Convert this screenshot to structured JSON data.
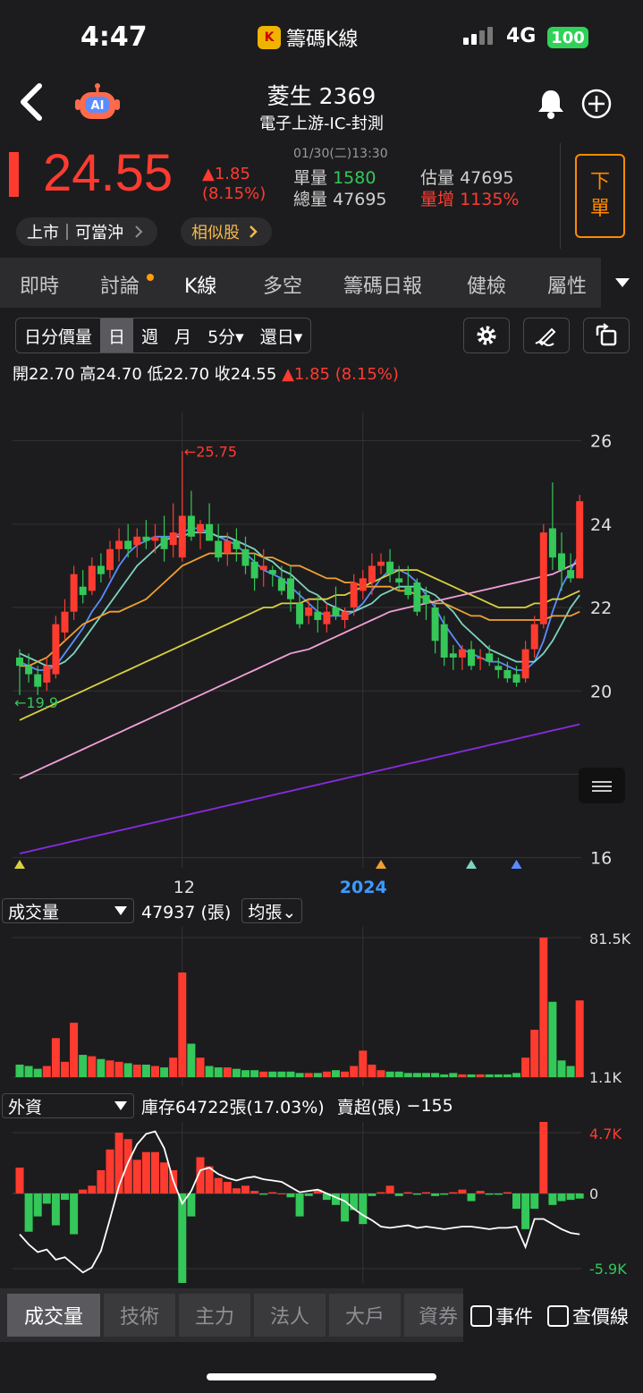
{
  "status_bar": {
    "time": "4:47",
    "app_name": "籌碼K線",
    "network": "4G",
    "battery": "100"
  },
  "header": {
    "stock_name": "菱生 2369",
    "industry": "電子上游-IC-封測",
    "back_icon": "chevron-left-icon",
    "ai_icon": "robot-ai-icon",
    "bell_icon": "bell-icon",
    "add_icon": "plus-circle-icon"
  },
  "quote": {
    "price": "24.55",
    "change": "▲1.85",
    "change_pct": "(8.15%)",
    "timestamp": "01/30(二)13:30",
    "single_vol_label": "單量",
    "single_vol": "1580",
    "total_vol_label": "總量",
    "total_vol": "47695",
    "est_vol_label": "估量",
    "est_vol": "47695",
    "vol_increase_label": "量增",
    "vol_increase": "1135%",
    "order_button": [
      "下",
      "單"
    ],
    "market_pill": "上市｜可當沖",
    "similar_pill": "相似股"
  },
  "tabs": [
    "即時",
    "討論",
    "K線",
    "多空",
    "籌碼日報",
    "健檢",
    "屬性"
  ],
  "active_tab": "K線",
  "period_selector": {
    "items": [
      "日分價量",
      "日",
      "週",
      "月",
      "5分▾",
      "還日▾"
    ],
    "selected": "日"
  },
  "ohlc": {
    "open_label": "開",
    "open": "22.70",
    "high_label": "高",
    "high": "24.70",
    "low_label": "低",
    "low": "22.70",
    "close_label": "收",
    "close": "24.55",
    "change": "▲1.85 (8.15%)"
  },
  "chart_data": {
    "type": "candlestick",
    "y_ticks": [
      "26",
      "24",
      "22",
      "20",
      "18",
      "16"
    ],
    "ylim": [
      15.8,
      26.7
    ],
    "x_labels": [
      {
        "text": "12",
        "at": 18
      },
      {
        "text": "2024",
        "at": 38
      }
    ],
    "annotations": {
      "high": "←25.75",
      "low": "←19.9"
    },
    "candles": [
      [
        20.8,
        21.0,
        19.9,
        20.6
      ],
      [
        20.6,
        20.9,
        20.2,
        20.4
      ],
      [
        20.4,
        20.6,
        19.9,
        20.1
      ],
      [
        20.2,
        20.8,
        20.0,
        20.6
      ],
      [
        20.4,
        21.8,
        20.3,
        21.6
      ],
      [
        21.4,
        22.2,
        21.2,
        21.9
      ],
      [
        21.9,
        23.0,
        21.7,
        22.8
      ],
      [
        22.5,
        22.9,
        22.1,
        22.3
      ],
      [
        22.4,
        23.2,
        22.3,
        23.0
      ],
      [
        23.0,
        23.3,
        22.6,
        22.8
      ],
      [
        22.9,
        23.6,
        22.7,
        23.4
      ],
      [
        23.4,
        23.9,
        23.1,
        23.6
      ],
      [
        23.6,
        24.0,
        23.2,
        23.4
      ],
      [
        23.5,
        23.9,
        23.2,
        23.7
      ],
      [
        23.7,
        24.1,
        23.4,
        23.6
      ],
      [
        23.6,
        24.0,
        23.3,
        23.7
      ],
      [
        23.7,
        24.2,
        23.1,
        23.4
      ],
      [
        23.5,
        24.5,
        23.2,
        23.8
      ],
      [
        23.2,
        25.75,
        23.1,
        24.2
      ],
      [
        24.2,
        24.8,
        23.6,
        23.7
      ],
      [
        23.8,
        24.1,
        23.4,
        24.0
      ],
      [
        24.0,
        24.5,
        23.6,
        23.6
      ],
      [
        23.6,
        24.0,
        23.1,
        23.2
      ],
      [
        23.3,
        23.8,
        23.0,
        23.6
      ],
      [
        23.6,
        23.9,
        23.1,
        23.4
      ],
      [
        23.4,
        23.7,
        22.8,
        23.0
      ],
      [
        23.1,
        23.3,
        22.4,
        22.7
      ],
      [
        22.9,
        23.4,
        22.5,
        23.0
      ],
      [
        22.9,
        23.0,
        22.5,
        22.8
      ],
      [
        22.7,
        23.0,
        22.3,
        22.4
      ],
      [
        22.7,
        23.0,
        21.9,
        22.2
      ],
      [
        22.1,
        22.4,
        21.5,
        21.6
      ],
      [
        21.8,
        22.2,
        21.6,
        22.0
      ],
      [
        21.9,
        22.3,
        21.4,
        21.7
      ],
      [
        21.6,
        22.1,
        21.4,
        21.9
      ],
      [
        22.0,
        22.5,
        21.7,
        21.8
      ],
      [
        21.7,
        22.0,
        21.5,
        21.9
      ],
      [
        22.0,
        22.8,
        21.8,
        22.6
      ],
      [
        22.4,
        22.9,
        22.2,
        22.7
      ],
      [
        22.6,
        23.3,
        22.3,
        23.0
      ],
      [
        23.0,
        23.3,
        22.8,
        23.1
      ],
      [
        23.1,
        23.4,
        22.6,
        22.8
      ],
      [
        22.7,
        23.0,
        22.4,
        22.6
      ],
      [
        22.5,
        23.0,
        22.2,
        22.3
      ],
      [
        22.6,
        22.7,
        21.8,
        21.9
      ],
      [
        22.3,
        22.5,
        21.7,
        22.1
      ],
      [
        22.0,
        22.2,
        20.9,
        21.2
      ],
      [
        21.6,
        21.8,
        20.6,
        20.8
      ],
      [
        20.9,
        21.1,
        20.5,
        20.8
      ],
      [
        20.8,
        21.1,
        20.5,
        21.0
      ],
      [
        21.0,
        21.2,
        20.5,
        20.6
      ],
      [
        20.8,
        21.0,
        20.5,
        20.8
      ],
      [
        20.9,
        21.1,
        20.6,
        20.7
      ],
      [
        20.6,
        20.8,
        20.3,
        20.5
      ],
      [
        20.5,
        20.7,
        20.2,
        20.3
      ],
      [
        20.4,
        20.6,
        20.1,
        20.2
      ],
      [
        20.3,
        21.2,
        20.2,
        21.0
      ],
      [
        21.0,
        21.8,
        20.8,
        21.6
      ],
      [
        21.6,
        24.0,
        21.5,
        23.8
      ],
      [
        23.9,
        25.0,
        22.9,
        23.2
      ],
      [
        23.3,
        23.8,
        22.4,
        22.9
      ],
      [
        22.9,
        23.3,
        22.6,
        22.7
      ],
      [
        22.7,
        24.7,
        22.7,
        24.55
      ]
    ],
    "ma_lines": [
      {
        "color": "#5b8cff",
        "values": [
          20.7,
          20.6,
          20.5,
          20.5,
          20.6,
          20.9,
          21.2,
          21.5,
          21.9,
          22.2,
          22.6,
          23.0,
          23.3,
          23.5,
          23.6,
          23.7,
          23.7,
          23.7,
          23.8,
          23.9,
          23.9,
          23.8,
          23.7,
          23.6,
          23.5,
          23.3,
          23.1,
          22.9,
          22.8,
          22.7,
          22.5,
          22.3,
          22.1,
          21.9,
          21.8,
          21.8,
          21.8,
          21.9,
          22.1,
          22.4,
          22.7,
          22.9,
          22.9,
          22.8,
          22.6,
          22.3,
          22.0,
          21.6,
          21.3,
          21.0,
          20.9,
          20.8,
          20.7,
          20.7,
          20.6,
          20.5,
          20.5,
          20.7,
          21.2,
          21.9,
          22.5,
          22.9,
          23.3
        ]
      },
      {
        "color": "#7dd3c0",
        "values": [
          20.9,
          20.8,
          20.7,
          20.6,
          20.6,
          20.7,
          20.9,
          21.2,
          21.5,
          21.8,
          22.1,
          22.4,
          22.7,
          23.0,
          23.2,
          23.4,
          23.6,
          23.7,
          23.7,
          23.8,
          23.8,
          23.8,
          23.7,
          23.7,
          23.6,
          23.5,
          23.4,
          23.2,
          23.1,
          22.9,
          22.8,
          22.6,
          22.4,
          22.3,
          22.1,
          22.0,
          21.9,
          21.9,
          22.0,
          22.1,
          22.3,
          22.4,
          22.5,
          22.5,
          22.5,
          22.4,
          22.3,
          22.1,
          21.9,
          21.6,
          21.4,
          21.2,
          21.0,
          20.9,
          20.8,
          20.7,
          20.7,
          20.7,
          20.9,
          21.2,
          21.6,
          22.0,
          22.3
        ]
      },
      {
        "color": "#f0a030",
        "values": [
          20.6,
          20.6,
          20.7,
          20.8,
          21.0,
          21.2,
          21.4,
          21.6,
          21.7,
          21.8,
          21.9,
          21.9,
          22.0,
          22.1,
          22.2,
          22.4,
          22.6,
          22.8,
          23.0,
          23.1,
          23.2,
          23.3,
          23.3,
          23.3,
          23.3,
          23.3,
          23.3,
          23.2,
          23.2,
          23.1,
          23.0,
          23.0,
          22.9,
          22.8,
          22.7,
          22.7,
          22.6,
          22.6,
          22.5,
          22.5,
          22.5,
          22.5,
          22.4,
          22.4,
          22.3,
          22.2,
          22.1,
          22.1,
          22.0,
          21.9,
          21.8,
          21.8,
          21.7,
          21.7,
          21.7,
          21.7,
          21.7,
          21.7,
          21.7,
          21.8,
          21.8,
          21.8,
          21.9
        ]
      },
      {
        "color": "#d9d040",
        "values": [
          19.3,
          19.4,
          19.5,
          19.6,
          19.7,
          19.8,
          19.9,
          20.0,
          20.1,
          20.2,
          20.3,
          20.4,
          20.5,
          20.6,
          20.7,
          20.8,
          20.9,
          21.0,
          21.1,
          21.2,
          21.3,
          21.4,
          21.5,
          21.6,
          21.7,
          21.8,
          21.9,
          22.0,
          22.0,
          22.1,
          22.1,
          22.1,
          22.2,
          22.2,
          22.2,
          22.3,
          22.3,
          22.4,
          22.5,
          22.6,
          22.7,
          22.8,
          22.9,
          22.9,
          22.9,
          22.8,
          22.7,
          22.6,
          22.5,
          22.4,
          22.3,
          22.2,
          22.1,
          22.0,
          22.0,
          22.0,
          22.0,
          22.1,
          22.1,
          22.2,
          22.2,
          22.3,
          22.4
        ]
      },
      {
        "color": "#f2a0d8",
        "values": [
          17.9,
          18.0,
          18.1,
          18.2,
          18.3,
          18.4,
          18.5,
          18.6,
          18.7,
          18.8,
          18.9,
          19.0,
          19.1,
          19.2,
          19.3,
          19.4,
          19.5,
          19.6,
          19.7,
          19.8,
          19.9,
          20.0,
          20.1,
          20.2,
          20.3,
          20.4,
          20.5,
          20.6,
          20.7,
          20.8,
          20.9,
          20.95,
          21.0,
          21.1,
          21.2,
          21.3,
          21.4,
          21.5,
          21.6,
          21.7,
          21.8,
          21.9,
          21.95,
          22.0,
          22.05,
          22.1,
          22.15,
          22.2,
          22.25,
          22.3,
          22.35,
          22.4,
          22.45,
          22.5,
          22.55,
          22.6,
          22.65,
          22.7,
          22.75,
          22.8,
          22.9,
          23.0,
          23.1
        ]
      },
      {
        "color": "#8a2be2",
        "values": [
          16.1,
          16.15,
          16.2,
          16.25,
          16.3,
          16.35,
          16.4,
          16.45,
          16.5,
          16.55,
          16.6,
          16.65,
          16.7,
          16.75,
          16.8,
          16.85,
          16.9,
          16.95,
          17.0,
          17.05,
          17.1,
          17.15,
          17.2,
          17.25,
          17.3,
          17.35,
          17.4,
          17.45,
          17.5,
          17.55,
          17.6,
          17.65,
          17.7,
          17.75,
          17.8,
          17.85,
          17.9,
          17.95,
          18.0,
          18.05,
          18.1,
          18.15,
          18.2,
          18.25,
          18.3,
          18.35,
          18.4,
          18.45,
          18.5,
          18.55,
          18.6,
          18.65,
          18.7,
          18.75,
          18.8,
          18.85,
          18.9,
          18.95,
          19.0,
          19.05,
          19.1,
          19.15,
          19.2
        ]
      }
    ],
    "markers": [
      {
        "at": 0,
        "color": "#d9d040"
      },
      {
        "at": 40,
        "color": "#f0a030"
      },
      {
        "at": 50,
        "color": "#7dd3c0"
      },
      {
        "at": 55,
        "color": "#5b8cff"
      }
    ],
    "volume": {
      "label": "成交量",
      "value": "47937 (張)",
      "unit_button": "均張⌄",
      "max_label": "81.5K",
      "min_label": "1.1K",
      "values": [
        9,
        8,
        6,
        8,
        28,
        11,
        39,
        16,
        15,
        13,
        12,
        11,
        10,
        9,
        9,
        8,
        7,
        14,
        75,
        24,
        14,
        8,
        7,
        7,
        6,
        5,
        5,
        4,
        4,
        4,
        4,
        3,
        3,
        3,
        4,
        5,
        4,
        8,
        19,
        9,
        5,
        4,
        4,
        3,
        3,
        3,
        3,
        2,
        3,
        2,
        2,
        2,
        2,
        2,
        2,
        3,
        14,
        34,
        100,
        54,
        12,
        8,
        55
      ]
    },
    "foreign": {
      "label": "外資",
      "summary": "庫存64722張(17.03%)",
      "net_label": "賣超(張)",
      "net": "−155",
      "max_label": "4.7K",
      "zero_label": "0",
      "min_label": "-5.9K",
      "values": [
        2.0,
        -3.0,
        -1.8,
        -0.8,
        -2.5,
        -0.5,
        -3.2,
        0.3,
        0.6,
        1.8,
        3.4,
        4.7,
        4.2,
        2.6,
        3.2,
        3.2,
        2.4,
        1.8,
        -7.5,
        -1.8,
        2.8,
        2.1,
        1.2,
        0.9,
        0.4,
        0.6,
        0.2,
        -0.1,
        0.1,
        0.0,
        -0.3,
        -1.8,
        -0.2,
        0.3,
        -0.5,
        -0.9,
        -2.2,
        -1.3,
        -2.4,
        -0.2,
        0.1,
        0.6,
        -0.2,
        0.1,
        -0.1,
        0.1,
        -0.2,
        -0.1,
        0.1,
        0.3,
        -0.6,
        0.2,
        -0.1,
        -0.1,
        0.1,
        -1.2,
        -2.8,
        -1.2,
        5.7,
        -0.9,
        -0.6,
        -0.5,
        -0.4
      ],
      "line": [
        -3.2,
        -4.0,
        -4.6,
        -4.4,
        -5.2,
        -5.0,
        -5.6,
        -6.2,
        -5.8,
        -4.5,
        -2.0,
        0.6,
        2.4,
        3.8,
        4.6,
        4.8,
        3.5,
        1.0,
        -0.8,
        0.2,
        1.8,
        2.0,
        1.5,
        1.2,
        1.0,
        1.2,
        1.3,
        1.1,
        1.0,
        0.9,
        0.5,
        0.1,
        0.2,
        0.3,
        0.0,
        -0.3,
        -0.6,
        -1.2,
        -1.7,
        -2.1,
        -2.6,
        -2.7,
        -2.6,
        -2.5,
        -2.7,
        -2.6,
        -2.7,
        -2.8,
        -2.7,
        -2.6,
        -2.6,
        -2.7,
        -2.8,
        -2.7,
        -2.7,
        -2.6,
        -4.2,
        -2.0,
        -2.0,
        -2.4,
        -2.8,
        -3.1,
        -3.2
      ]
    }
  },
  "bottom_tabs": [
    "成交量",
    "技術",
    "主力",
    "法人",
    "大戶",
    "資券"
  ],
  "active_bottom_tab": "成交量",
  "checkboxes": [
    "事件",
    "查價線"
  ]
}
